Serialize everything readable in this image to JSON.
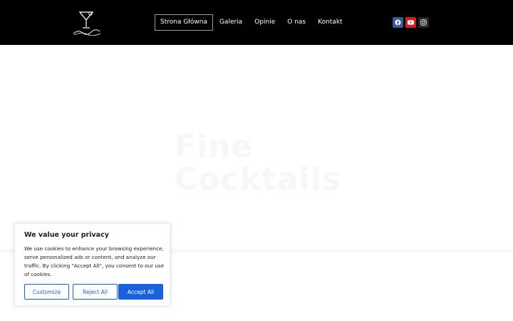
{
  "header": {
    "logo_alt": "FineCocktails",
    "nav": [
      {
        "label": "Strona Główna",
        "active": true
      },
      {
        "label": "Galeria",
        "active": false
      },
      {
        "label": "Opinie",
        "active": false
      },
      {
        "label": "O nas",
        "active": false
      },
      {
        "label": "Kontakt",
        "active": false
      }
    ],
    "social": [
      {
        "icon": "facebook-icon",
        "color": "#3b5998"
      },
      {
        "icon": "youtube-icon",
        "color": "#cd201f"
      },
      {
        "icon": "instagram-icon",
        "color": "#262626"
      }
    ]
  },
  "hero": {
    "title": "Fine Cocktails"
  },
  "cookie_banner": {
    "title": "We value your privacy",
    "text": "We use cookies to enhance your browsing experience, serve personalized ads or content, and analyze our traffic. By clicking \"Accept All\", you consent to our use of cookies.",
    "customize_label": "Customize",
    "reject_label": "Reject All",
    "accept_label": "Accept All",
    "accent_color": "#1863dc"
  }
}
